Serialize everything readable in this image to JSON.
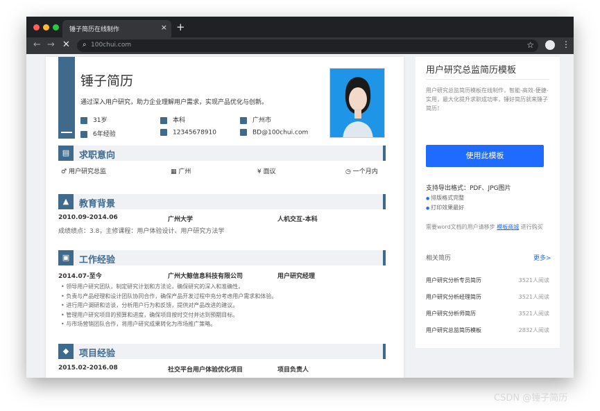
{
  "browser": {
    "tab_title": "锤子简历在线制作",
    "url": "100chui.com"
  },
  "resume": {
    "name": "锤子简历",
    "intro": "通过深入用户研究，助力企业理解用户需求，实现产品优化与创新。",
    "info": [
      {
        "icon": "person-icon",
        "text": "31岁"
      },
      {
        "icon": "graduation-icon",
        "text": "本科"
      },
      {
        "icon": "location-icon",
        "text": "广州市"
      },
      {
        "icon": "briefcase-icon",
        "text": "6年经验"
      },
      {
        "icon": "phone-icon",
        "text": "12345678910"
      },
      {
        "icon": "mail-icon",
        "text": "BD@100chui.com"
      }
    ],
    "sections": {
      "intent": {
        "title": "求职意向",
        "items": [
          "用户研究总监",
          "广州",
          "面议",
          "一个月内"
        ]
      },
      "education": {
        "title": "教育背景",
        "date": "2010.09-2014.06",
        "school": "广州大学",
        "major": "人机交互-本科",
        "detail": "成绩绩点：3.8，主修课程：用户体验设计、用户研究方法学"
      },
      "work": {
        "title": "工作经验",
        "date": "2014.07-至今",
        "company": "广州大鲸信息科技有限公司",
        "role": "用户研究经理",
        "bullets": [
          "领导用户研究团队，制定研究计划和方法论，确保研究的深入和准确性。",
          "负责与产品经理和设计团队协同合作，确保产品开发过程中充分考虑用户需求和体验。",
          "进行用户调研和访谈，分析用户行为和反馈，提供对产品改进的建议。",
          "管理用户研究项目的预算和进度，确保项目按时交付并达到预期目标。",
          "与市场营销团队合作，将用户研究成果转化为市场推广策略。"
        ]
      },
      "project": {
        "title": "项目经验",
        "date": "2015.02-2016.08",
        "name": "社交平台用户体验优化项目",
        "role": "项目负责人"
      }
    }
  },
  "sidebar": {
    "title": "用户研究总监简历模板",
    "desc": "用户研究总监简历模板在线制作，智能-高效-便捷-实用，最大化提升求职成功率，锤好简历就来锤子简历！",
    "use_button": "使用此模板",
    "formats": "支持导出格式：PDF、JPG图片",
    "features": [
      "排版格式完整",
      "打印效果最好"
    ],
    "word_prefix": "需要word文档的用户请移步",
    "word_link": "模板商城",
    "word_suffix": "进行购买",
    "related_title": "相关简历",
    "more": "更多>",
    "related": [
      {
        "name": "用户研究分析专员简历",
        "count": "3521人阅读"
      },
      {
        "name": "用户研究分析经理简历",
        "count": "3521人阅读"
      },
      {
        "name": "用户研究分析师简历",
        "count": "3521人阅读"
      },
      {
        "name": "用户研究总监简历模板",
        "count": "2832人阅读"
      }
    ]
  },
  "watermark": "CSDN @锤子简历"
}
